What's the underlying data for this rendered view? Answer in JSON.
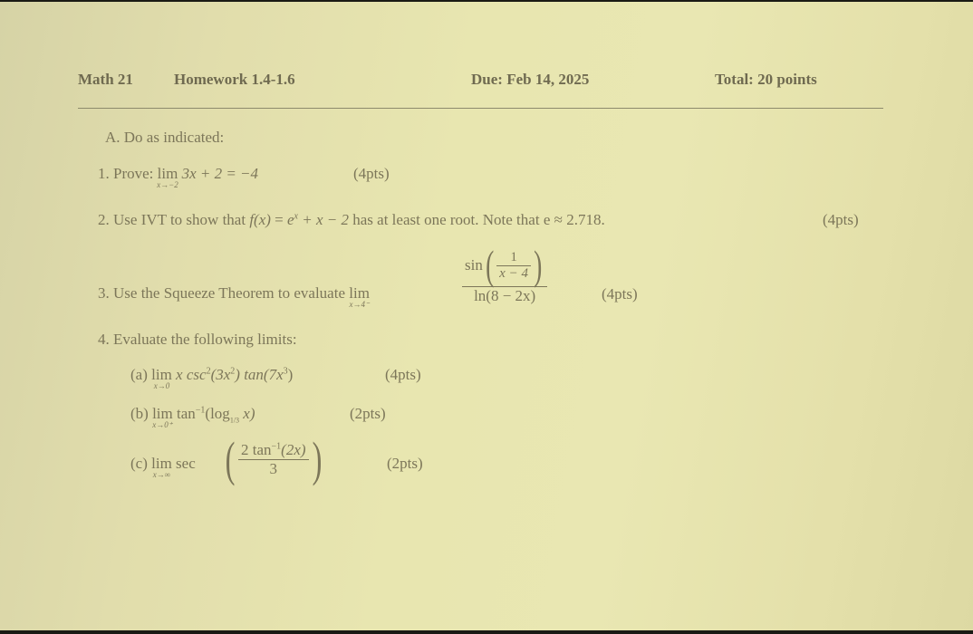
{
  "header": {
    "course": "Math 21",
    "title": "Homework 1.4-1.6",
    "due": "Due: Feb 14, 2025",
    "total": "Total: 20 points"
  },
  "section": {
    "heading": "A. Do as indicated:"
  },
  "problems": [
    {
      "number": "1.",
      "text": "Prove:",
      "lim": "lim",
      "lim_sub": "x→−2",
      "expr": "3x + 2 = −4",
      "points": "(4pts)"
    },
    {
      "number": "2.",
      "text_before": "Use IVT to show that",
      "fx": "f(x)",
      "eq": " = ",
      "ex_base": "e",
      "ex_exp": "x",
      "rest": " + x − 2",
      "text_after": "has at least one root. Note that",
      "e_approx": "e ≈ 2.718.",
      "points": "(4pts)"
    },
    {
      "number": "3.",
      "text": "Use the Squeeze Theorem to evaluate",
      "lim": "lim",
      "lim_sub": "x→4⁻",
      "sin": "sin",
      "inner_num": "1",
      "inner_den": "x − 4",
      "denominator": "ln(8 − 2x)",
      "points": "(4pts)"
    },
    {
      "number": "4.",
      "text": "Evaluate the following limits:",
      "parts": [
        {
          "label": "(a)",
          "lim": "lim",
          "lim_sub": "x→0",
          "expr_a": "x csc",
          "exp_a": "2",
          "expr_b": "(3x",
          "exp_b": "2",
          "expr_c": ") tan(7x",
          "exp_c": "3",
          "expr_d": ")",
          "points": "(4pts)"
        },
        {
          "label": "(b)",
          "lim": "lim",
          "lim_sub": "x→0⁺",
          "expr_a": "tan",
          "exp_a": "−1",
          "expr_b": "(log",
          "log_base": "1/3",
          "expr_c": " x)",
          "points": "(2pts)"
        },
        {
          "label": "(c)",
          "lim": "lim",
          "lim_sub": "x→∞",
          "sec": "sec",
          "num_a": "2 tan",
          "num_exp": "−1",
          "num_b": "(2x)",
          "den": "3",
          "points": "(2pts)"
        }
      ]
    }
  ]
}
